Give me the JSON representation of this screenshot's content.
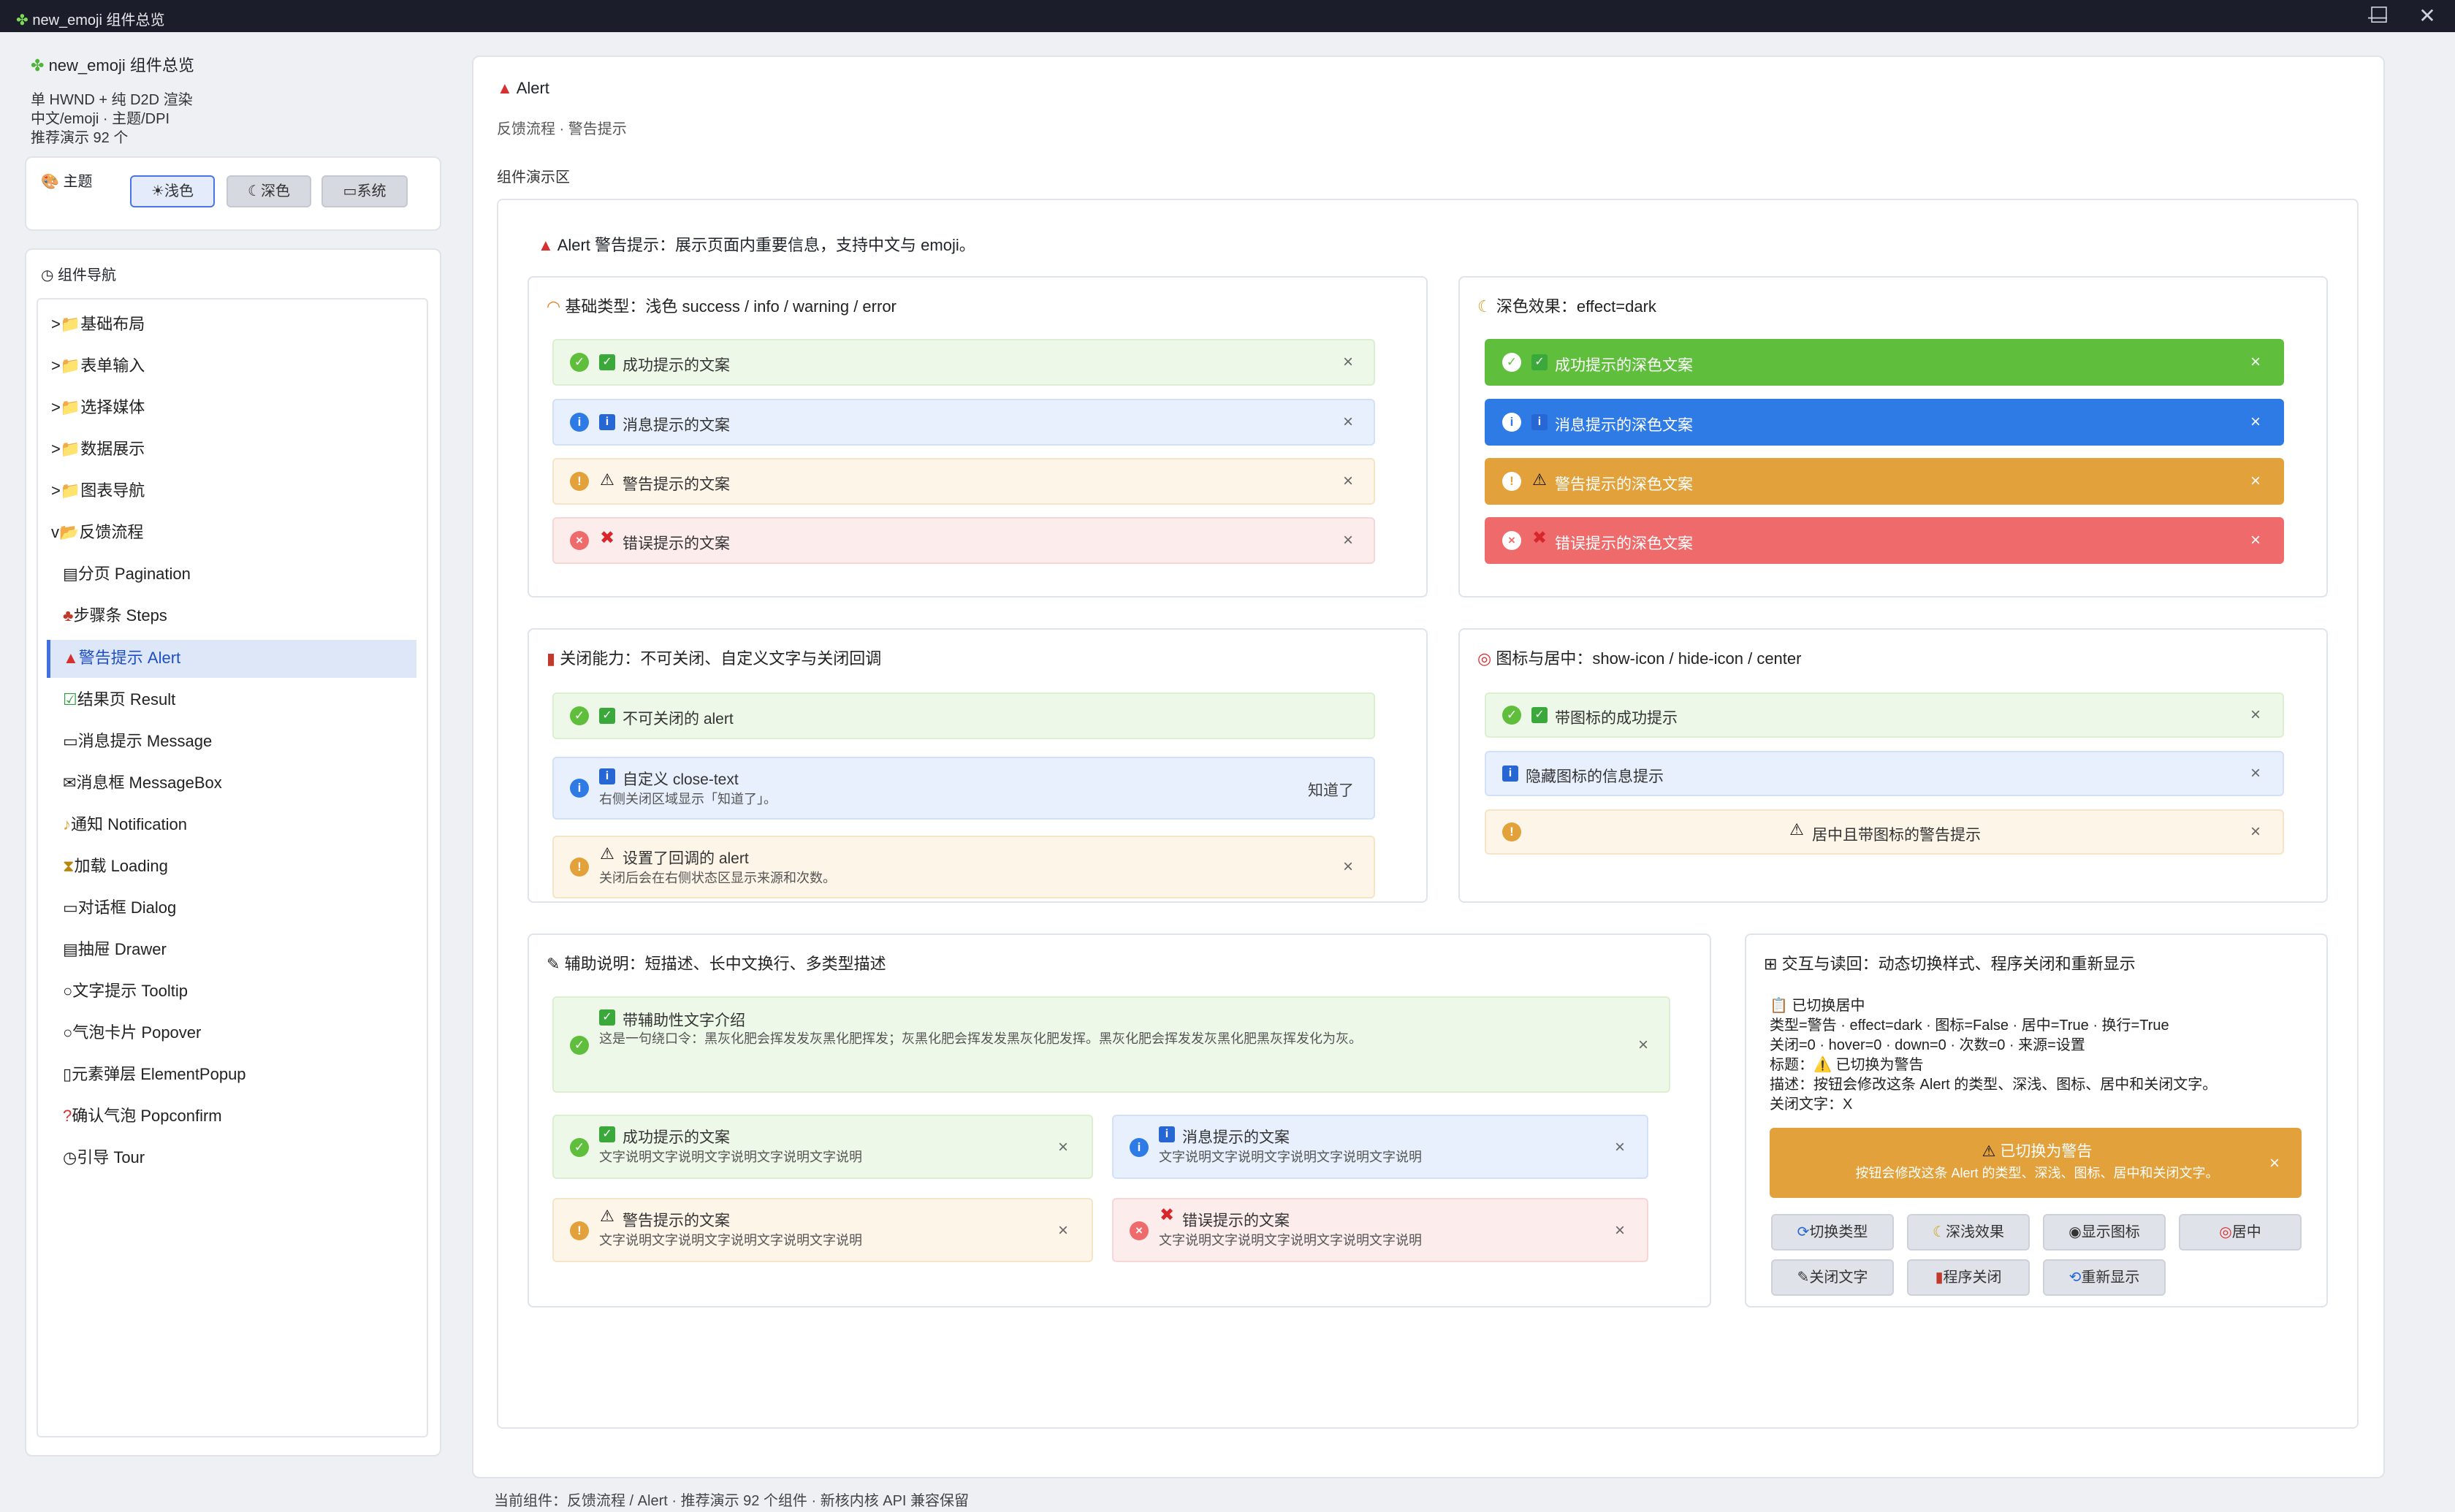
{
  "window": {
    "title": "new_emoji 组件总览",
    "controls": [
      "—",
      "☐",
      "✕"
    ]
  },
  "sidebar": {
    "app_title": "new_emoji 组件总览",
    "subtitle_lines": [
      "单 HWND + 纯 D2D 渲染",
      "中文/emoji · 主题/DPI",
      "推荐演示 92 个"
    ],
    "theme_label": "主题",
    "theme_buttons": [
      {
        "label": "浅色",
        "icon": "sun-icon"
      },
      {
        "label": "深色",
        "icon": "moon-icon"
      },
      {
        "label": "系统",
        "icon": "laptop-icon"
      }
    ],
    "nav_title": "组件导航",
    "nav_items": [
      {
        "label": ">📁基础布局"
      },
      {
        "label": ">📁表单输入"
      },
      {
        "label": ">📁选择媒体"
      },
      {
        "label": ">📁数据展示"
      },
      {
        "label": ">📁图表导航"
      },
      {
        "label": "v📂反馈流程"
      },
      {
        "label": "分页 Pagination"
      },
      {
        "label": "步骤条 Steps"
      },
      {
        "label": "警告提示 Alert"
      },
      {
        "label": "结果页 Result"
      },
      {
        "label": "消息提示 Message"
      },
      {
        "label": "消息框 MessageBox"
      },
      {
        "label": "通知 Notification"
      },
      {
        "label": "加载 Loading"
      },
      {
        "label": "对话框 Dialog"
      },
      {
        "label": "抽屉 Drawer"
      },
      {
        "label": "文字提示 Tooltip"
      },
      {
        "label": "气泡卡片 Popover"
      },
      {
        "label": "元素弹层 ElementPopup"
      },
      {
        "label": "确认气泡 Popconfirm"
      },
      {
        "label": "引导 Tour"
      }
    ]
  },
  "main": {
    "title": "Alert",
    "breadcrumb": "反馈流程 · 警告提示",
    "demo_label": "组件演示区",
    "intro": "Alert 警告提示：展示页面内重要信息，支持中文与 emoji。",
    "card_basic": {
      "title": "基础类型：浅色 success / info / warning / error",
      "alerts": [
        "成功提示的文案",
        "消息提示的文案",
        "警告提示的文案",
        "错误提示的文案"
      ]
    },
    "card_dark": {
      "title": "深色效果：effect=dark",
      "alerts": [
        "成功提示的深色文案",
        "消息提示的深色文案",
        "警告提示的深色文案",
        "错误提示的深色文案"
      ]
    },
    "card_close": {
      "title": "关闭能力：不可关闭、自定义文字与关闭回调",
      "a1": "不可关闭的 alert",
      "a2_title": "自定义 close-text",
      "a2_desc": "右侧关闭区域显示「知道了」。",
      "a2_close": "知道了",
      "a3_title": "设置了回调的 alert",
      "a3_desc": "关闭后会在右侧状态区显示来源和次数。"
    },
    "card_icon": {
      "title": "图标与居中：show-icon / hide-icon / center",
      "a1": "带图标的成功提示",
      "a2": "隐藏图标的信息提示",
      "a3": "居中且带图标的警告提示"
    },
    "card_desc": {
      "title": "辅助说明：短描述、长中文换行、多类型描述",
      "big_title": "带辅助性文字介绍",
      "big_desc": "这是一句绕口令：黑灰化肥会挥发发灰黑化肥挥发；灰黑化肥会挥发发黑灰化肥发挥。黑灰化肥会挥发发灰黑化肥黑灰挥发化为灰。",
      "items": [
        {
          "title": "成功提示的文案",
          "desc": "文字说明文字说明文字说明文字说明文字说明"
        },
        {
          "title": "消息提示的文案",
          "desc": "文字说明文字说明文字说明文字说明文字说明"
        },
        {
          "title": "警告提示的文案",
          "desc": "文字说明文字说明文字说明文字说明文字说明"
        },
        {
          "title": "错误提示的文案",
          "desc": "文字说明文字说明文字说明文字说明文字说明"
        }
      ]
    },
    "card_interact": {
      "title": "交互与读回：动态切换样式、程序关闭和重新显示",
      "status_lines": [
        "📋 已切换居中",
        "类型=警告 · effect=dark · 图标=False · 居中=True · 换行=True",
        "关闭=0 · hover=0 · down=0 · 次数=0 · 来源=设置",
        "标题：⚠️ 已切换为警告",
        "描述：按钮会修改这条 Alert 的类型、深浅、图标、居中和关闭文字。",
        "关闭文字：X"
      ],
      "preview_title": "已切换为警告",
      "preview_desc": "按钮会修改这条 Alert 的类型、深浅、图标、居中和关闭文字。",
      "buttons": [
        "切换类型",
        "深浅效果",
        "显示图标",
        "居中",
        "关闭文字",
        "程序关闭",
        "重新显示"
      ]
    },
    "footer": "当前组件：反馈流程 / Alert · 推荐演示 92 个组件 · 新核内核 API 兼容保留"
  },
  "colors": {
    "success": "#5fbf3c",
    "info": "#2f7be6",
    "warning": "#e2a13a",
    "error": "#ef6b6b",
    "accent": "#3f6fe0"
  }
}
